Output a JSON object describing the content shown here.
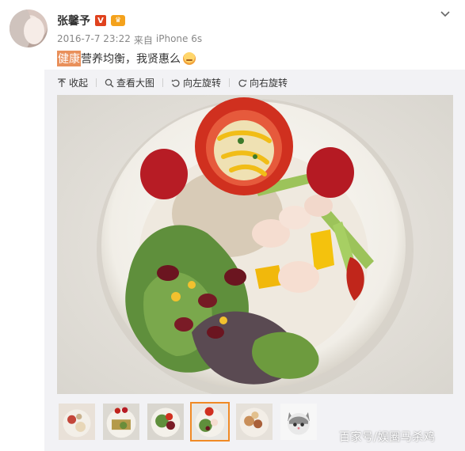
{
  "post": {
    "author": "张馨予",
    "verified_badge": "V",
    "timestamp": "2016-7-7 23:22",
    "source_prefix": "来自",
    "device": "iPhone 6s",
    "text_highlight": "健康",
    "text_rest": "营养均衡，我贤惠么"
  },
  "toolbar": {
    "collapse_label": "收起",
    "view_large_label": "查看大图",
    "rotate_left_label": "向左旋转",
    "rotate_right_label": "向右旋转"
  },
  "thumbnails": {
    "count": 6,
    "active_index": 3
  },
  "watermark": {
    "text": "百家号/娱圈马杀鸡"
  },
  "colors": {
    "accent": "#f08a25",
    "highlight": "#e9905b",
    "verified": "#e0421e",
    "panel_bg": "#f2f2f5"
  },
  "icons": {
    "collapse": "arrow-up-icon",
    "view_large": "magnifier-icon",
    "rotate_left": "rotate-left-icon",
    "rotate_right": "rotate-right-icon",
    "more": "chevron-down-icon"
  }
}
